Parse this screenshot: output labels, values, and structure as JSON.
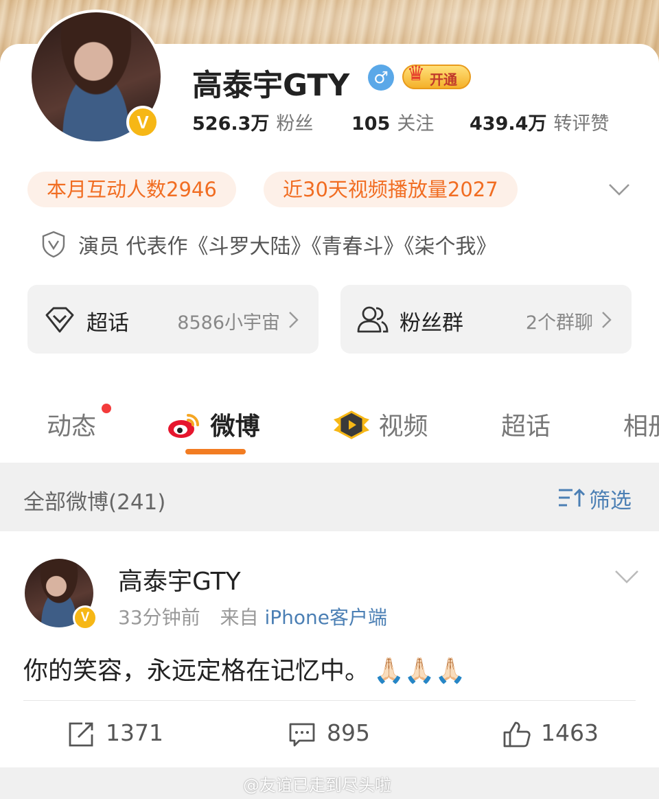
{
  "profile": {
    "name": "高泰宇GTY",
    "gender_icon": "male-icon",
    "vip_label": "开通",
    "stats": [
      {
        "num": "526.3万",
        "label": "粉丝"
      },
      {
        "num": "105",
        "label": "关注"
      },
      {
        "num": "439.4万",
        "label": "转评赞"
      }
    ],
    "pills": [
      "本月互动人数2946",
      "近30天视频播放量2027"
    ],
    "intro": "演员 代表作《斗罗大陆》《青春斗》《柒个我》"
  },
  "tiles": [
    {
      "title": "超话",
      "value": "8586小宇宙",
      "icon": "diamond-icon"
    },
    {
      "title": "粉丝群",
      "value": "2个群聊",
      "icon": "users-icon"
    }
  ],
  "tabs": [
    {
      "label": "动态"
    },
    {
      "label": "微博",
      "icon": "weibo-icon"
    },
    {
      "label": "视频",
      "icon": "video-badge-icon"
    },
    {
      "label": "超话"
    },
    {
      "label": "相册"
    }
  ],
  "filter_bar": {
    "all_label": "全部微博(241)",
    "filter_label": "筛选"
  },
  "post": {
    "author": "高泰宇GTY",
    "time": "33分钟前",
    "from_prefix": "来自",
    "source": "iPhone客户端",
    "text": "你的笑容，永远定格在记忆中。",
    "emojis": "🙏🏻🙏🏻🙏🏻",
    "actions": {
      "repost": "1371",
      "comment": "895",
      "like": "1463"
    }
  },
  "watermark": "@友谊已走到尽头啦",
  "colors": {
    "accent": "#f27c22",
    "pill_text": "#f16d22",
    "link": "#4b7fb4",
    "verified": "#f6b716"
  }
}
